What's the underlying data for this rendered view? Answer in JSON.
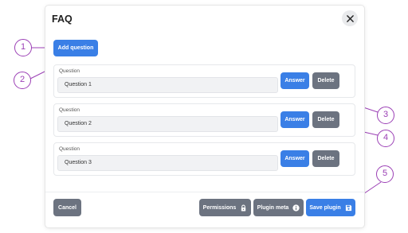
{
  "dialog": {
    "title": "FAQ",
    "add_question_label": "Add question",
    "questions": [
      {
        "label": "Question",
        "value": "Question 1",
        "answer_label": "Answer",
        "delete_label": "Delete"
      },
      {
        "label": "Question",
        "value": "Question 2",
        "answer_label": "Answer",
        "delete_label": "Delete"
      },
      {
        "label": "Question",
        "value": "Question 3",
        "answer_label": "Answer",
        "delete_label": "Delete"
      }
    ],
    "footer": {
      "cancel_label": "Cancel",
      "permissions_label": "Permissions",
      "plugin_meta_label": "Plugin meta",
      "save_label": "Save plugin"
    }
  },
  "callouts": [
    "1",
    "2",
    "3",
    "4",
    "5"
  ],
  "icons": {
    "close": "close-icon",
    "permissions": "lock-icon",
    "plugin_meta": "info-icon",
    "save": "save-icon"
  },
  "colors": {
    "primary": "#3a7fe6",
    "secondary": "#6c7380",
    "callout": "#9b3fb5"
  }
}
